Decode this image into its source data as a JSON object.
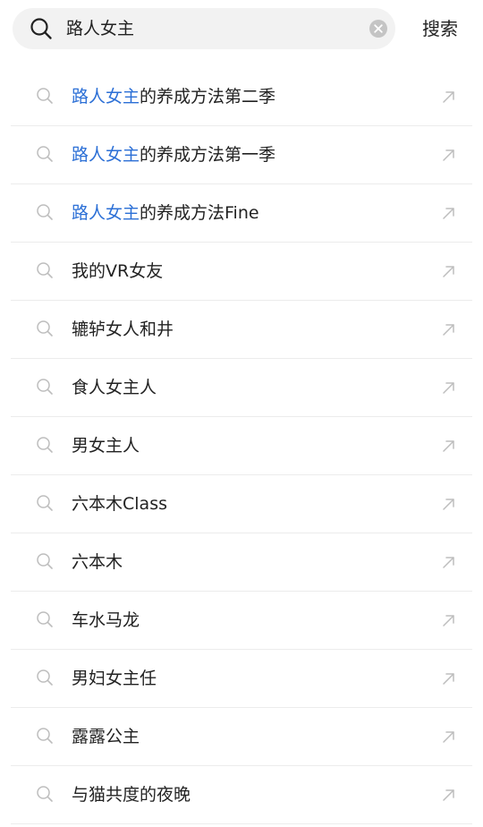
{
  "search": {
    "query": "路人女主",
    "button_label": "搜索",
    "highlight_color": "#2b6fd6"
  },
  "suggestions": [
    {
      "highlight": "路人女主",
      "rest": "的养成方法第二季"
    },
    {
      "highlight": "路人女主",
      "rest": "的养成方法第一季"
    },
    {
      "highlight": "路人女主",
      "rest": "的养成方法Fine"
    },
    {
      "highlight": "",
      "rest": "我的VR女友"
    },
    {
      "highlight": "",
      "rest": "辘轳女人和井"
    },
    {
      "highlight": "",
      "rest": "食人女主人"
    },
    {
      "highlight": "",
      "rest": "男女主人"
    },
    {
      "highlight": "",
      "rest": "六本木Class"
    },
    {
      "highlight": "",
      "rest": "六本木"
    },
    {
      "highlight": "",
      "rest": "车水马龙"
    },
    {
      "highlight": "",
      "rest": "男妇女主任"
    },
    {
      "highlight": "",
      "rest": "露露公主"
    },
    {
      "highlight": "",
      "rest": "与猫共度的夜晚"
    }
  ],
  "icons": {
    "search": "search-icon",
    "clear": "clear-icon",
    "suggestion_search": "search-icon",
    "fill_arrow": "arrow-up-left-icon"
  }
}
